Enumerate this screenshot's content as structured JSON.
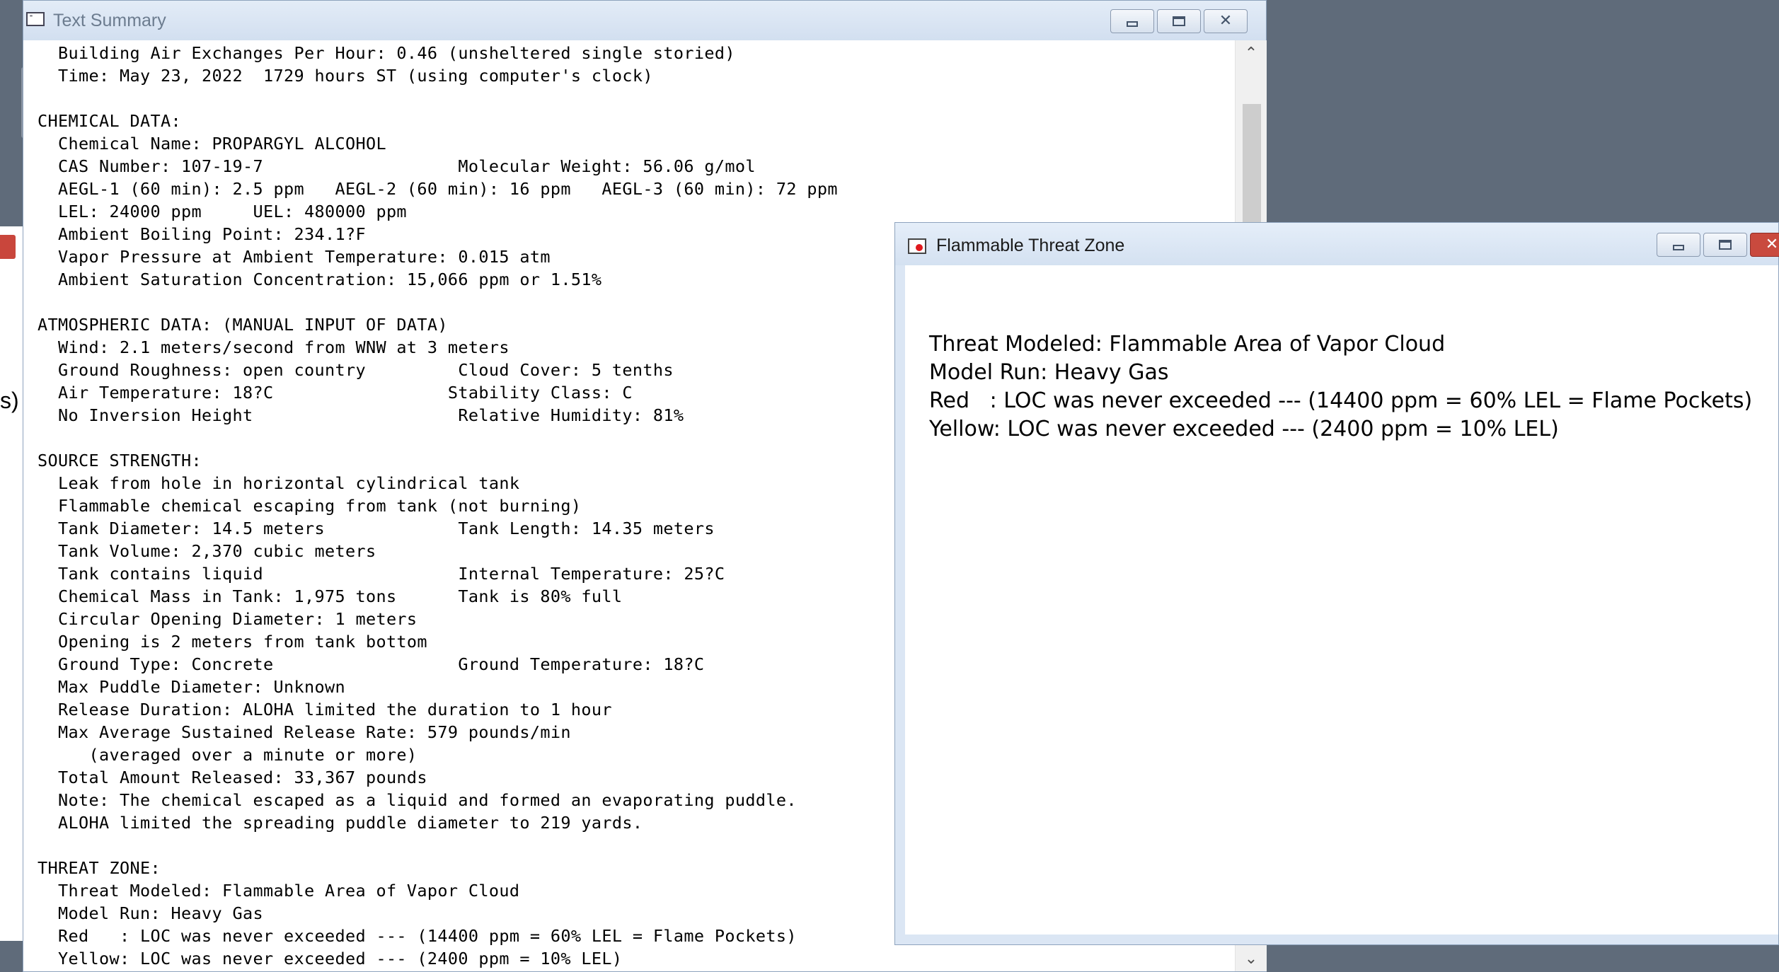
{
  "background_window": {
    "visible_glyph": "s)"
  },
  "text_summary": {
    "title": "Text Summary",
    "lines": [
      "  Building Air Exchanges Per Hour: 0.46 (unsheltered single storied)",
      "  Time: May 23, 2022  1729 hours ST (using computer's clock)",
      "",
      "CHEMICAL DATA:",
      "  Chemical Name: PROPARGYL ALCOHOL",
      "  CAS Number: 107-19-7                   Molecular Weight: 56.06 g/mol",
      "  AEGL-1 (60 min): 2.5 ppm   AEGL-2 (60 min): 16 ppm   AEGL-3 (60 min): 72 ppm",
      "  LEL: 24000 ppm     UEL: 480000 ppm",
      "  Ambient Boiling Point: 234.1?F",
      "  Vapor Pressure at Ambient Temperature: 0.015 atm",
      "  Ambient Saturation Concentration: 15,066 ppm or 1.51%",
      "",
      "ATMOSPHERIC DATA: (MANUAL INPUT OF DATA)",
      "  Wind: 2.1 meters/second from WNW at 3 meters",
      "  Ground Roughness: open country         Cloud Cover: 5 tenths",
      "  Air Temperature: 18?C                 Stability Class: C",
      "  No Inversion Height                    Relative Humidity: 81%",
      "",
      "SOURCE STRENGTH:",
      "  Leak from hole in horizontal cylindrical tank",
      "  Flammable chemical escaping from tank (not burning)",
      "  Tank Diameter: 14.5 meters             Tank Length: 14.35 meters",
      "  Tank Volume: 2,370 cubic meters",
      "  Tank contains liquid                   Internal Temperature: 25?C",
      "  Chemical Mass in Tank: 1,975 tons      Tank is 80% full",
      "  Circular Opening Diameter: 1 meters",
      "  Opening is 2 meters from tank bottom",
      "  Ground Type: Concrete                  Ground Temperature: 18?C",
      "  Max Puddle Diameter: Unknown",
      "  Release Duration: ALOHA limited the duration to 1 hour",
      "  Max Average Sustained Release Rate: 579 pounds/min",
      "     (averaged over a minute or more)",
      "  Total Amount Released: 33,367 pounds",
      "  Note: The chemical escaped as a liquid and formed an evaporating puddle.",
      "  ALOHA limited the spreading puddle diameter to 219 yards.",
      "",
      "THREAT ZONE:",
      "  Threat Modeled: Flammable Area of Vapor Cloud",
      "  Model Run: Heavy Gas",
      "  Red   : LOC was never exceeded --- (14400 ppm = 60% LEL = Flame Pockets)",
      "  Yellow: LOC was never exceeded --- (2400 ppm = 10% LEL)"
    ],
    "scroll_up": "^",
    "scroll_down": "v"
  },
  "flammable_threat_zone": {
    "title": "Flammable Threat Zone",
    "lines": [
      "Threat Modeled: Flammable Area of Vapor Cloud",
      "Model Run: Heavy Gas",
      "Red   : LOC was never exceeded --- (14400 ppm = 60% LEL = Flame Pockets)",
      "Yellow: LOC was never exceeded --- (2400 ppm = 10% LEL)"
    ]
  }
}
